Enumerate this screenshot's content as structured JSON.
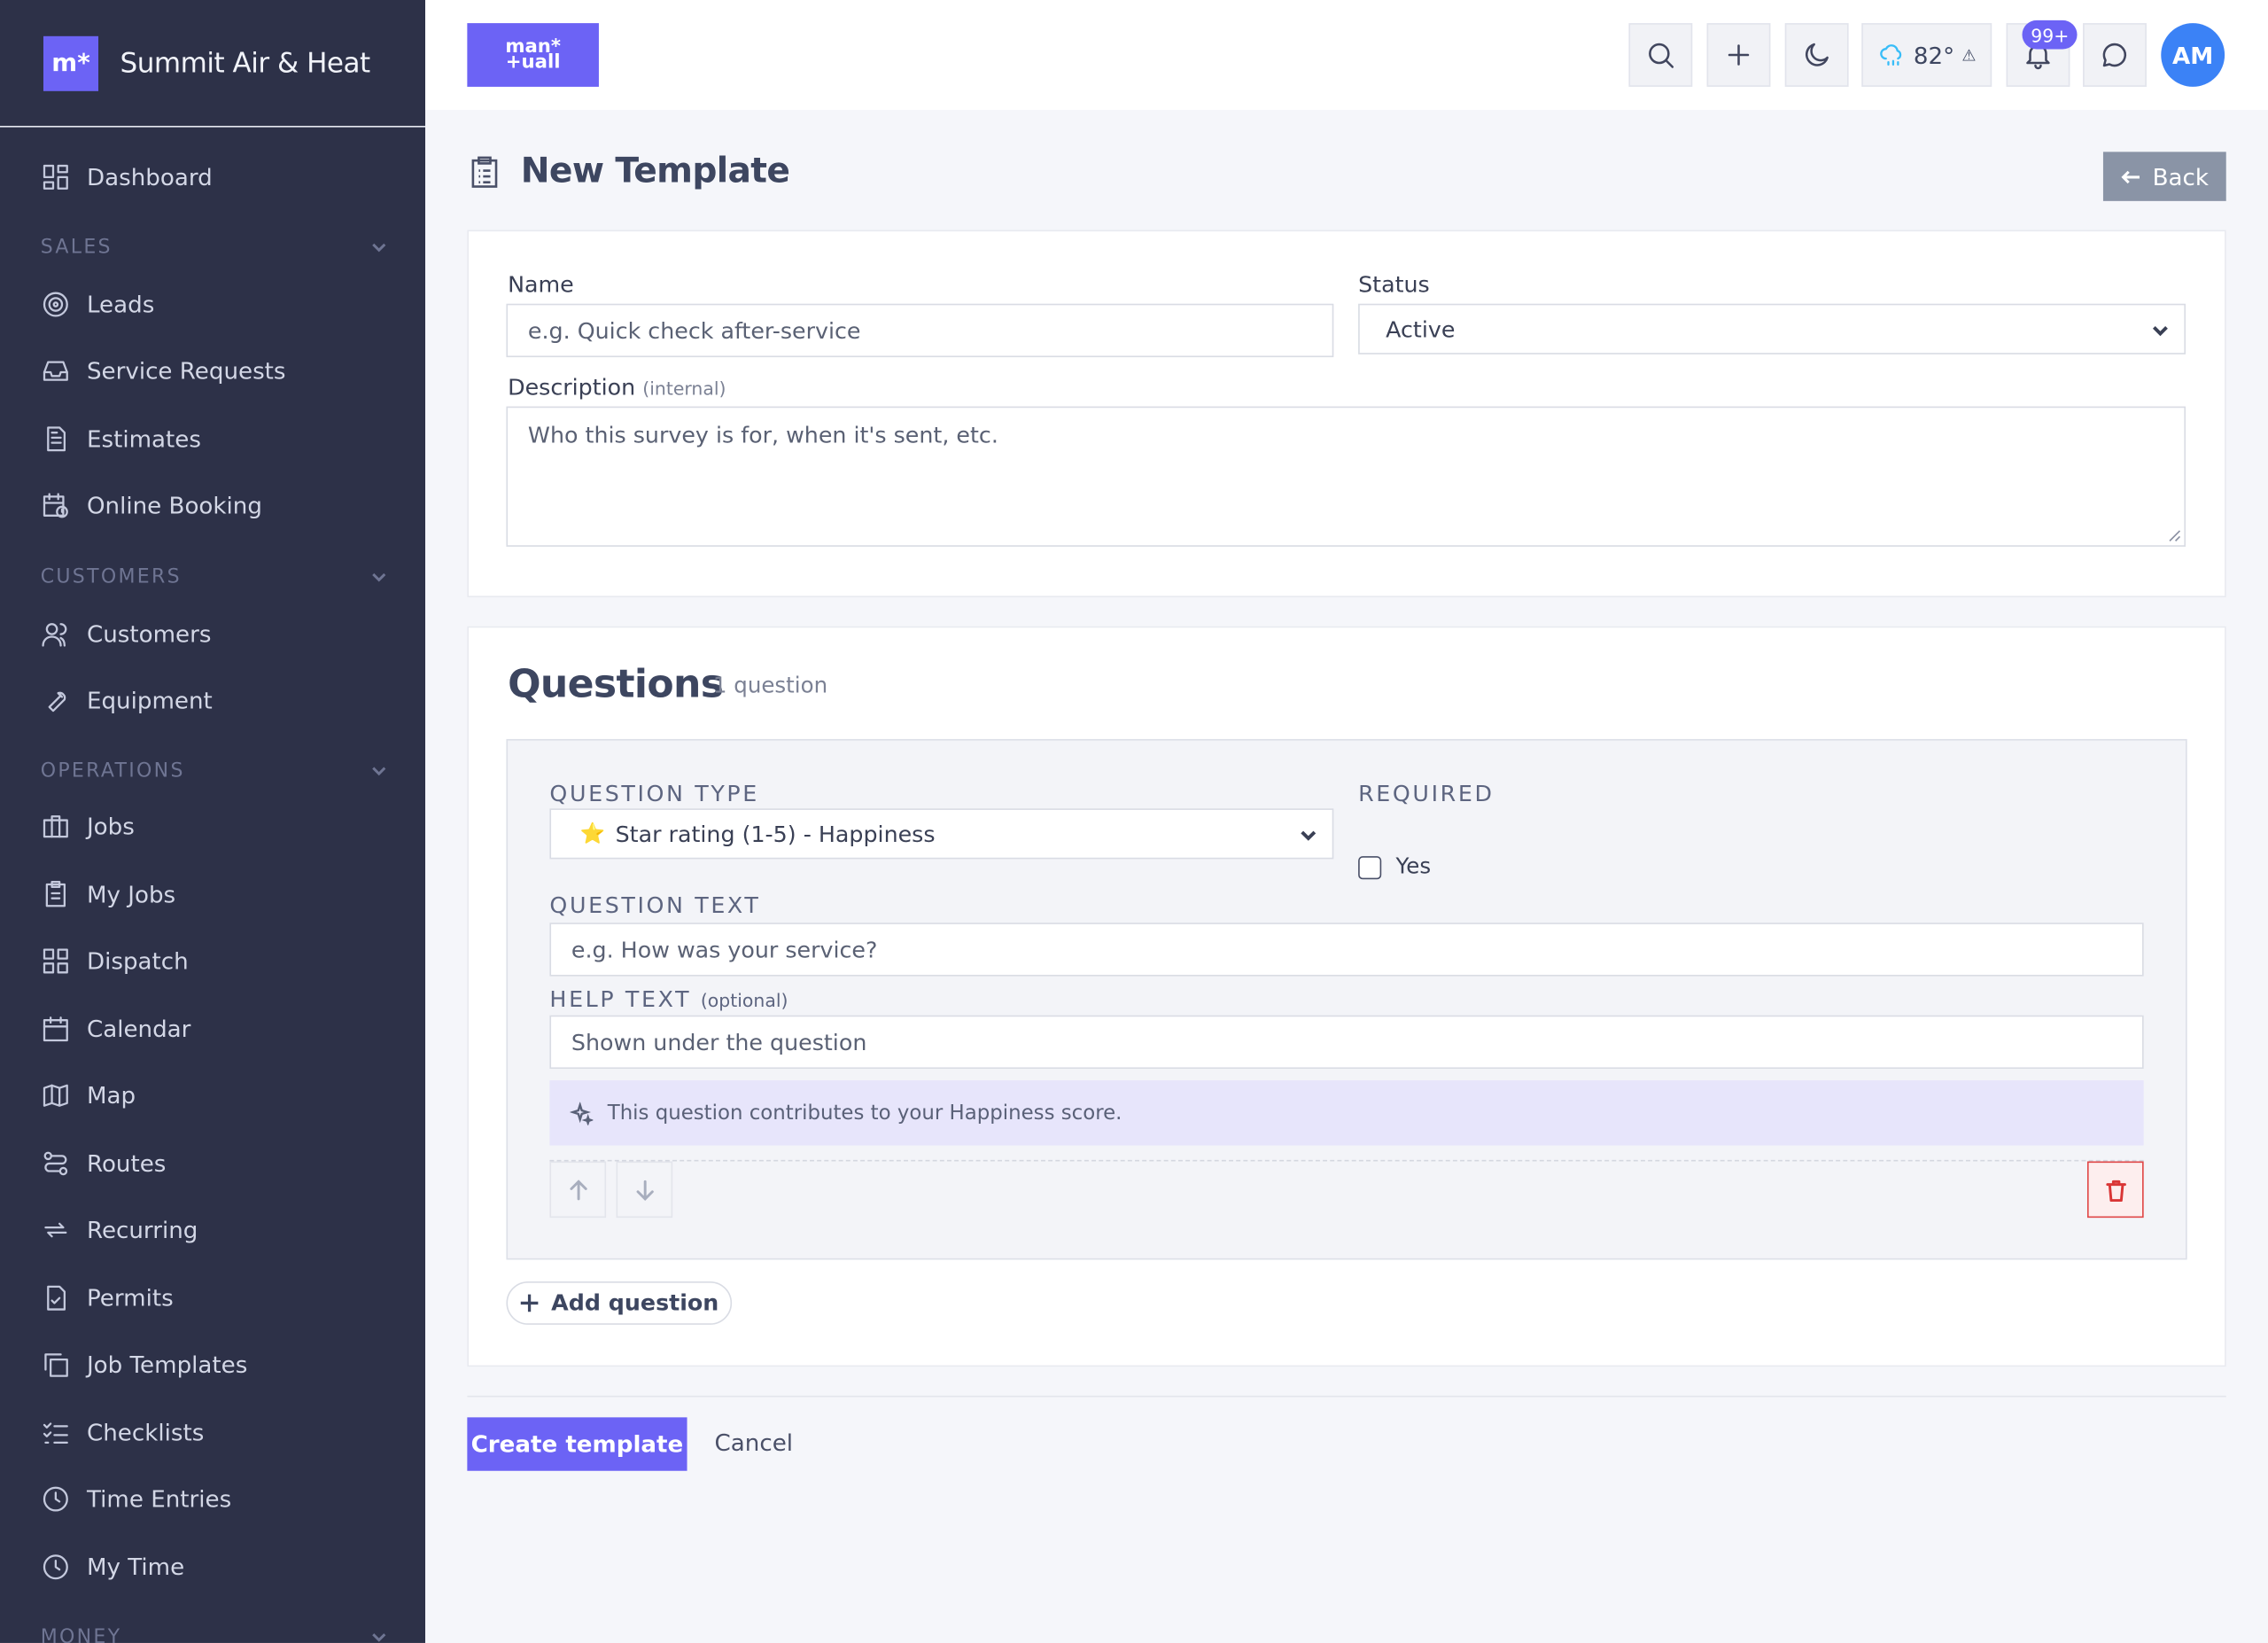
{
  "sidebar": {
    "brand_logo": "m*",
    "brand_name": "Summit Air & Heat",
    "items": {
      "dashboard": "Dashboard",
      "leads": "Leads",
      "service_requests": "Service Requests",
      "estimates": "Estimates",
      "online_booking": "Online Booking",
      "customers": "Customers",
      "equipment": "Equipment",
      "jobs": "Jobs",
      "my_jobs": "My Jobs",
      "dispatch": "Dispatch",
      "calendar": "Calendar",
      "map": "Map",
      "routes": "Routes",
      "recurring": "Recurring",
      "permits": "Permits",
      "job_templates": "Job Templates",
      "checklists": "Checklists",
      "time_entries": "Time Entries",
      "my_time": "My Time"
    },
    "sections": {
      "sales": "SALES",
      "customers": "CUSTOMERS",
      "operations": "OPERATIONS",
      "money": "MONEY"
    }
  },
  "topbar": {
    "logo_line1": "man*",
    "logo_line2": "+uall",
    "weather_temp": "82°",
    "weather_alert": "⚠",
    "notifications_badge": "99+",
    "avatar_initials": "AM"
  },
  "page": {
    "title": "New Template",
    "back_label": "Back"
  },
  "form": {
    "name_label": "Name",
    "name_placeholder": "e.g. Quick check after-service",
    "status_label": "Status",
    "status_value": "Active",
    "description_label": "Description",
    "description_hint": "(internal)",
    "description_placeholder": "Who this survey is for, when it's sent, etc."
  },
  "questions": {
    "title": "Questions",
    "count": "1 question",
    "type_label": "QUESTION TYPE",
    "type_icon": "⭐",
    "type_value": "Star rating (1-5) - Happiness",
    "required_label": "REQUIRED",
    "required_option": "Yes",
    "text_label": "QUESTION TEXT",
    "text_placeholder": "e.g. How was your service?",
    "help_label": "HELP TEXT",
    "help_hint": "(optional)",
    "help_placeholder": "Shown under the question",
    "info": "This question contributes to your Happiness score.",
    "add_label": "Add question"
  },
  "actions": {
    "create_label": "Create template",
    "cancel_label": "Cancel"
  },
  "colors": {
    "accent": "#6c63f5",
    "sidebar_bg": "#2d3148",
    "danger": "#d93636"
  }
}
